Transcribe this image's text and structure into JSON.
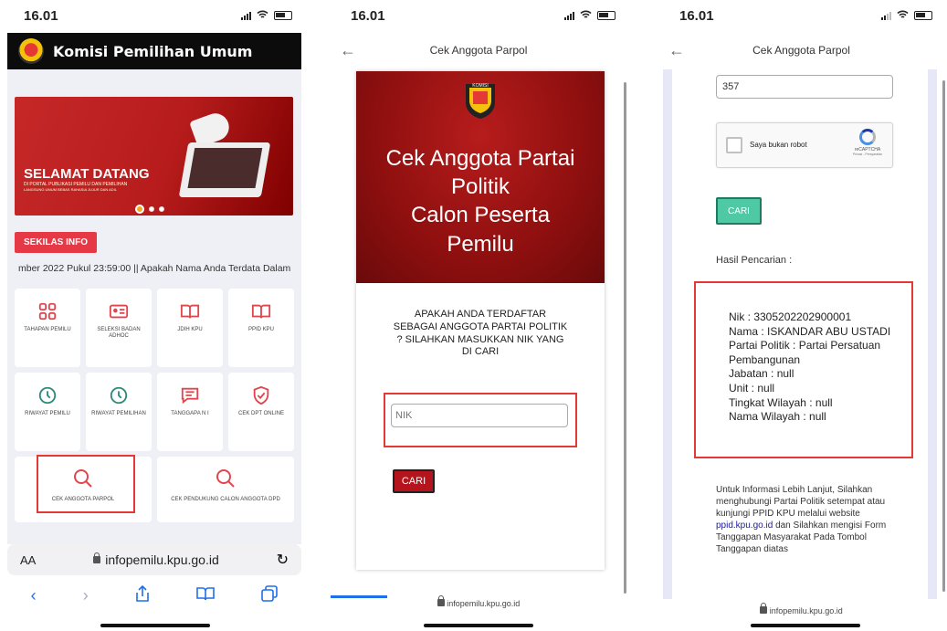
{
  "panel1": {
    "status": {
      "time": "16.01"
    },
    "header": {
      "title": "Komisi Pemilihan Umum"
    },
    "banner": {
      "title": "SELAMAT DATANG",
      "subtitle": "DI PORTAL PUBLIKASI PEMILU DAN PEMILIHAN",
      "tagline": "LANGSUNG UMUM BEBAS RAHASIA JUJUR DAN ADIL"
    },
    "sekilas_label": "SEKILAS INFO",
    "ticker": "mber 2022 Pukul 23:59:00 || Apakah Nama Anda Terdata Dalam",
    "tiles": [
      {
        "label": "TAHAPAN PEMILU",
        "icon": "grid-icon"
      },
      {
        "label": "SELEKSI BADAN ADHOC",
        "icon": "id-card-icon"
      },
      {
        "label": "JDIH KPU",
        "icon": "book-icon"
      },
      {
        "label": "PPID KPU",
        "icon": "book-icon"
      },
      {
        "label": "RIWAYAT PEMILU",
        "icon": "clock-icon"
      },
      {
        "label": "RIWAYAT PEMILIHAN",
        "icon": "clock-icon"
      },
      {
        "label": "TANGGAPA N I",
        "icon": "chat-icon"
      },
      {
        "label": "CEK DPT ONLINE",
        "icon": "shield-icon"
      }
    ],
    "wide_tiles": [
      {
        "label": "CEK ANGGOTA PARPOL",
        "icon": "search-icon"
      },
      {
        "label": "CEK PENDUKUNG CALON ANGGOTA DPD",
        "icon": "search-icon"
      }
    ],
    "browser": {
      "aa": "AA",
      "url": "infopemilu.kpu.go.id"
    },
    "colors": {
      "accent": "#e53946",
      "header_bg": "#0c0c0c",
      "link_blue": "#1e6fe8"
    }
  },
  "panel2": {
    "status": {
      "time": "16.01"
    },
    "nav_title": "Cek Anggota Parpol",
    "hero_title_lines": [
      "Cek Anggota Partai",
      "Politik",
      "Calon Peserta",
      "Pemilu"
    ],
    "question": "APAKAH ANDA TERDAFTAR SEBAGAI ANGGOTA PARTAI POLITIK ? SILAHKAN MASUKKAN NIK YANG DI CARI",
    "nik_placeholder": "NIK",
    "search_button": "CARI",
    "footer_url": "infopemilu.kpu.go.id",
    "colors": {
      "hero": "#8e0f0f",
      "button": "#b5141c"
    }
  },
  "panel3": {
    "status": {
      "time": "16.01"
    },
    "nav_title": "Cek Anggota Parpol",
    "nik_value": "357",
    "recaptcha": {
      "label": "Saya bukan robot",
      "brand": "reCAPTCHA",
      "links": "Privasi - Persyaratan"
    },
    "search_button": "CARI",
    "hasil_label": "Hasil Pencarian :",
    "result": {
      "nik": "Nik : 3305202202900001",
      "nama": "Nama : ISKANDAR ABU USTADI",
      "partai": "Partai Politik : Partai Persatuan Pembangunan",
      "jabatan": "Jabatan : null",
      "unit": "Unit : null",
      "tingkat": "Tingkat Wilayah : null",
      "wilayah": "Nama Wilayah : null"
    },
    "info_before": "Untuk Informasi Lebih Lanjut, Silahkan menghubungi Partai Politik setempat atau kunjungi PPID KPU melalui website",
    "info_link": "ppid.kpu.go.id",
    "info_after": "dan Silahkan mengisi Form Tanggapan Masyarakat Pada Tombol Tanggapan diatas",
    "footer_url": "infopemilu.kpu.go.id",
    "colors": {
      "button": "#4fc9a4",
      "highlight": "#e53935"
    }
  }
}
